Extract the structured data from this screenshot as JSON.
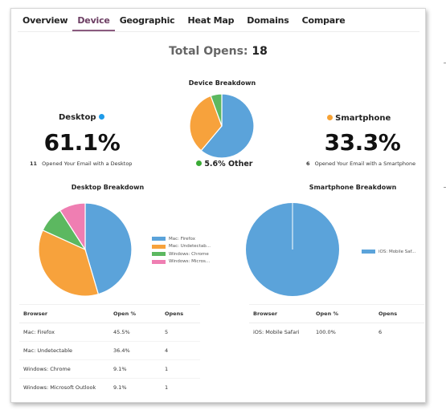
{
  "tabs": [
    {
      "label": "Overview",
      "active": false
    },
    {
      "label": "Device",
      "active": true
    },
    {
      "label": "Geographic",
      "active": false
    },
    {
      "label": "Heat Map",
      "active": false
    },
    {
      "label": "Domains",
      "active": false
    },
    {
      "label": "Compare",
      "active": false
    }
  ],
  "total": {
    "label": "Total Opens:",
    "value": "18"
  },
  "desktop": {
    "label": "Desktop",
    "percent": "61.1%",
    "count": "11",
    "description": "Opened Your Email with a Desktop",
    "color": "#1e9be9"
  },
  "smartphone": {
    "label": "Smartphone",
    "percent": "33.3%",
    "count": "6",
    "description": "Opened Your Email with a Smartphone",
    "color": "#f7a234"
  },
  "other": {
    "text": "5.6% Other",
    "color": "#3aaa35"
  },
  "chart_data": [
    {
      "type": "pie",
      "title": "Device Breakdown",
      "labels": [
        "Desktop",
        "Smartphone",
        "Other"
      ],
      "values": [
        61.1,
        33.3,
        5.6
      ],
      "colors": [
        "#5ba3da",
        "#f7a23c",
        "#5cb860"
      ]
    },
    {
      "type": "pie",
      "title": "Desktop Breakdown",
      "labels": [
        "Mac: Firefox",
        "Mac: Undetectab...",
        "Windows: Chrome",
        "Windows: Micros..."
      ],
      "values": [
        45.5,
        36.4,
        9.1,
        9.1
      ],
      "colors": [
        "#5ba3da",
        "#f7a23c",
        "#5cb860",
        "#ef7eb2"
      ],
      "legend": "right"
    },
    {
      "type": "pie",
      "title": "Smartphone Breakdown",
      "labels": [
        "iOS: Mobile Saf..."
      ],
      "values": [
        100.0
      ],
      "colors": [
        "#5ba3da"
      ],
      "legend": "right"
    }
  ],
  "desktop_table": {
    "headers": [
      "Browser",
      "Open %",
      "Opens"
    ],
    "rows": [
      [
        "Mac: Firefox",
        "45.5%",
        "5"
      ],
      [
        "Mac: Undetectable",
        "36.4%",
        "4"
      ],
      [
        "Windows: Chrome",
        "9.1%",
        "1"
      ],
      [
        "Windows: Microsoft Outlook",
        "9.1%",
        "1"
      ]
    ]
  },
  "smartphone_table": {
    "headers": [
      "Browser",
      "Open %",
      "Opens"
    ],
    "rows": [
      [
        "iOS: Mobile Safari",
        "100.0%",
        "6"
      ]
    ]
  }
}
